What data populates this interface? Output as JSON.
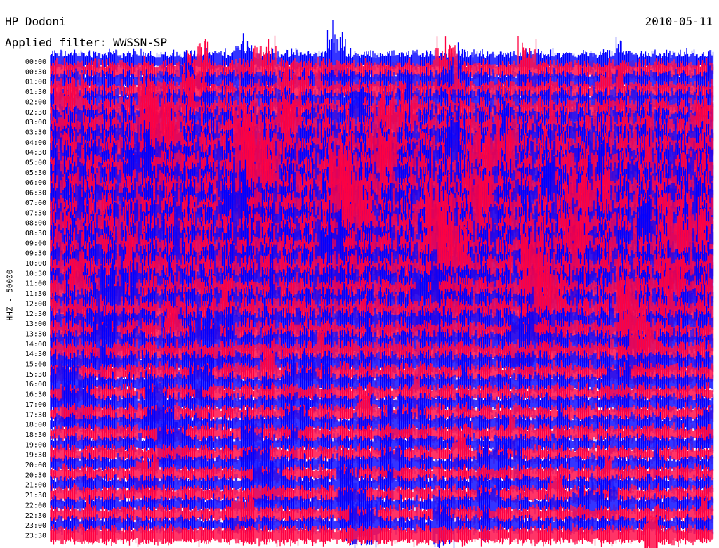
{
  "header": {
    "station": "HP Dodoni",
    "filter": "Applied filter: WWSSN-SP",
    "date": "2010-05-11"
  },
  "chart_data": {
    "type": "line",
    "title": "HP Dodoni",
    "subtitle": "Applied filter: WWSSN-SP",
    "date": "2010-05-11",
    "ylabel": "HHZ - 50000",
    "row_labels": [
      "00:00",
      "00:30",
      "01:00",
      "01:30",
      "02:00",
      "02:30",
      "03:00",
      "03:30",
      "04:00",
      "04:30",
      "05:00",
      "05:30",
      "06:00",
      "06:30",
      "07:00",
      "07:30",
      "08:00",
      "08:30",
      "09:00",
      "09:30",
      "10:00",
      "10:30",
      "11:00",
      "11:30",
      "12:00",
      "12:30",
      "13:00",
      "13:30",
      "14:00",
      "14:30",
      "15:00",
      "15:30",
      "16:00",
      "16:30",
      "17:00",
      "17:30",
      "18:00",
      "18:30",
      "19:00",
      "19:30",
      "20:00",
      "20:30",
      "21:00",
      "21:30",
      "22:00",
      "22:30",
      "23:00",
      "23:30"
    ],
    "colors": {
      "even_rows": "#0000ff",
      "odd_rows": "#ff0040"
    },
    "grid": false,
    "legend": "none",
    "row_amplitude": [
      0.95,
      1.0,
      1.0,
      1.0,
      1.2,
      1.3,
      1.5,
      1.7,
      1.8,
      1.9,
      2.0,
      2.0,
      2.0,
      2.0,
      2.0,
      2.0,
      2.0,
      2.0,
      2.0,
      2.0,
      1.9,
      1.8,
      1.7,
      1.6,
      1.5,
      1.5,
      1.4,
      1.3,
      1.3,
      1.2,
      1.1,
      1.0,
      0.95,
      0.9,
      0.9,
      0.9,
      0.9,
      0.9,
      0.85,
      0.85,
      0.85,
      0.85,
      0.85,
      0.85,
      0.85,
      0.85,
      0.8,
      0.9
    ]
  }
}
